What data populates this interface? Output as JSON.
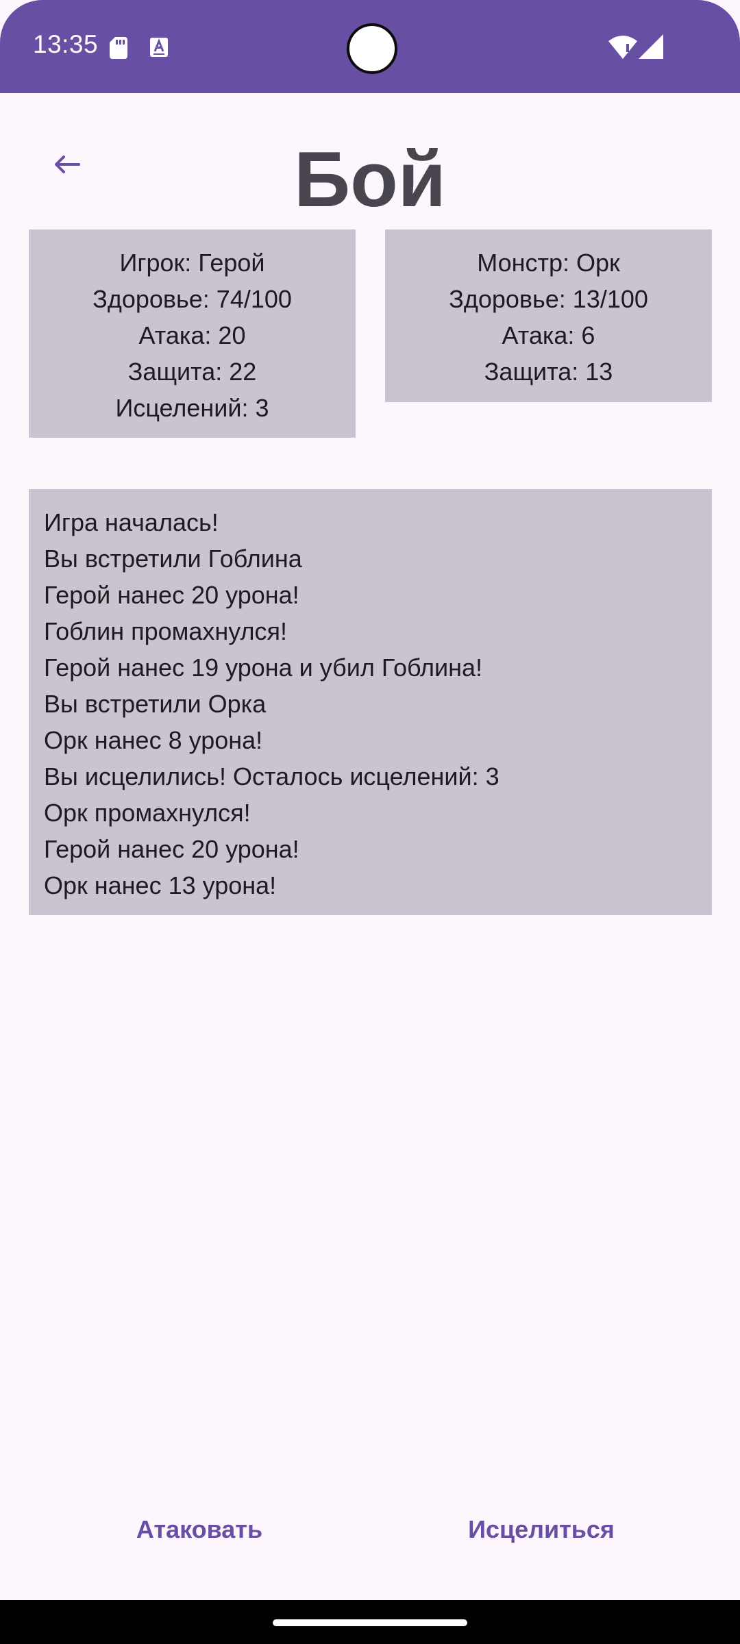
{
  "status_bar": {
    "time": "13:35",
    "icons": [
      "sd-card-icon",
      "accessibility-a-icon",
      "wifi-icon",
      "signal-icon"
    ]
  },
  "header": {
    "back_icon": "arrow-back-icon",
    "title": "Бой"
  },
  "player": {
    "name": "Игрок: Герой",
    "health": "Здоровье: 74/100",
    "attack": "Атака: 20",
    "defense": "Защита: 22",
    "heals": "Исцелений: 3"
  },
  "monster": {
    "name": "Монстр: Орк",
    "health": "Здоровье: 13/100",
    "attack": "Атака: 6",
    "defense": "Защита: 13"
  },
  "battle_log": [
    "Игра началась!",
    "Вы встретили Гоблина",
    "Герой нанес 20 урона!",
    "Гоблин промахнулся!",
    "Герой нанес 19 урона и убил Гоблина!",
    "Вы встретили Орка",
    "Орк нанес 8 урона!",
    "Вы исцелились! Осталось исцелений: 3",
    "Орк промахнулся!",
    "Герой нанес 20 урона!",
    "Орк нанес 13 урона!"
  ],
  "actions": {
    "attack_label": "Атаковать",
    "heal_label": "Исцелиться"
  },
  "colors": {
    "status_bar": "#6750a4",
    "background": "#fdf7fd",
    "card": "#cac4d0",
    "accent": "#6750a4",
    "title": "#49454f"
  }
}
